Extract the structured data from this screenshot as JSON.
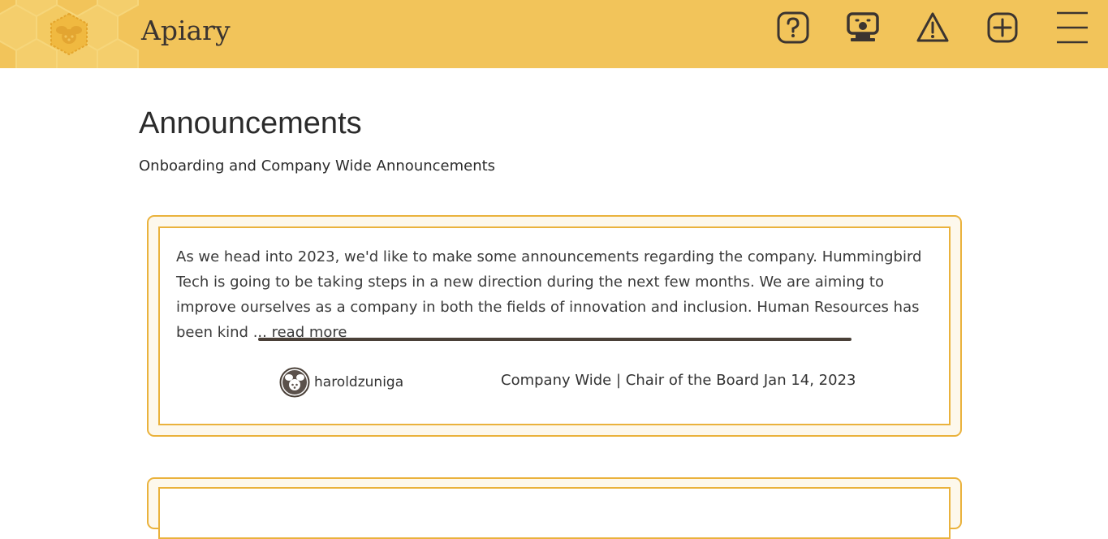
{
  "header": {
    "app_title": "Apiary",
    "icons": [
      "help-icon",
      "presentation-icon",
      "warning-icon",
      "add-icon",
      "menu-icon"
    ],
    "colors": {
      "bar": "#f2c45a",
      "icon": "#3b3430"
    }
  },
  "page": {
    "title": "Announcements",
    "subtitle": "Onboarding and Company Wide Announcements"
  },
  "announcements": [
    {
      "body": "As we head into 2023, we'd like to make some announcements regarding the company. Hummingbird Tech is going to be taking steps in a new direction during the next few months. We are aiming to improve ourselves as a company in both the fields of innovation and inclusion. Human Resources has been kind",
      "read_more": "... read more",
      "author": "haroldzuniga",
      "meta": "Company Wide | Chair of the Board Jan 14, 2023"
    }
  ],
  "colors": {
    "card_border": "#eab23c",
    "divider": "#4a4038"
  }
}
